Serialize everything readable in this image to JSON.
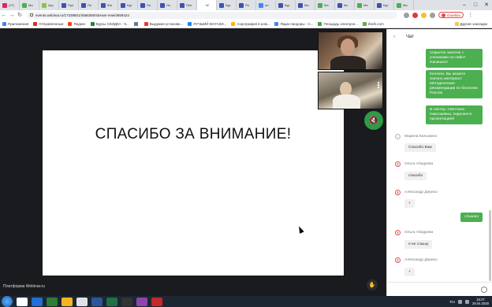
{
  "browser": {
    "tabs": [
      {
        "title": "(27)",
        "color": "#e0245e"
      },
      {
        "title": "Ма",
        "color": "#4caf50"
      },
      {
        "title": "Арс",
        "color": "#8bc34a"
      },
      {
        "title": "Пре",
        "color": "#3f51b5"
      },
      {
        "title": "Ли",
        "color": "#3f51b5"
      },
      {
        "title": "Жи",
        "color": "#3f51b5"
      },
      {
        "title": "Кур",
        "color": "#3f51b5"
      },
      {
        "title": "Ли",
        "color": "#3f51b5"
      },
      {
        "title": "Но",
        "color": "#3f51b5"
      },
      {
        "title": "Пен",
        "color": "#3f51b5"
      },
      {
        "title": "W",
        "color": "#ffffff"
      },
      {
        "title": "Кур",
        "color": "#3f51b5"
      },
      {
        "title": "Ра",
        "color": "#3f51b5"
      },
      {
        "title": "ал",
        "color": "#4285f4"
      },
      {
        "title": "Кур",
        "color": "#3f51b5"
      },
      {
        "title": "Ма",
        "color": "#3f51b5"
      },
      {
        "title": "Ма",
        "color": "#4caf50"
      },
      {
        "title": "bio",
        "color": "#3f51b5"
      },
      {
        "title": "Ма",
        "color": "#4caf50"
      },
      {
        "title": "Кур",
        "color": "#3f51b5"
      },
      {
        "title": "Ма",
        "color": "#4caf50"
      }
    ],
    "active_tab": 10,
    "url": "events.webinar.ru/17339801/4566360/stream-new/4658424",
    "profile_label": "Ошибка",
    "bookmarks": [
      {
        "label": "Приложения",
        "color": "#4285f4"
      },
      {
        "label": "Отправленные",
        "color": "#d93025"
      },
      {
        "label": "Яндекс",
        "color": "#fc3f1d"
      },
      {
        "label": "Курсы СКИДКА - 5...",
        "color": "#2e7d32"
      },
      {
        "label": "",
        "color": "#607d8b"
      },
      {
        "label": "Выдумая установк...",
        "color": "#e53935"
      },
      {
        "label": "ЛУЧШИЙ МАГАЗИ...",
        "color": "#1e88e5"
      },
      {
        "label": "Аэрография в аэ&...",
        "color": "#ffb300"
      },
      {
        "label": "Ящик пандоры - С...",
        "color": "#4285f4"
      },
      {
        "label": "Площадь электрон...",
        "color": "#43a047"
      },
      {
        "label": "iherb.com",
        "color": "#6aa84f"
      }
    ],
    "bookmarks_other": "Другие закладки"
  },
  "stage": {
    "slide_text": "СПАСИБО ЗА ВНИМАНИЕ!",
    "brand": "Платформа Webinar.ru"
  },
  "chat": {
    "title": "Чат",
    "outgoing": [
      "открытое занятие с учениками он-лайн? Напишите",
      "Коллеги. Вы можете скачать материал: Методические рекомендации по биологии Рохлов",
      "И лектор, Светлана Николаевна, поделился презентацией"
    ],
    "messages": [
      {
        "sender": "Марина Балыкина",
        "text": "Спасибо Вам",
        "avatar": "grey"
      },
      {
        "sender": "Ольга Абидуева",
        "text": "спасибо",
        "avatar": "red"
      },
      {
        "sender": "Александр Дерихо",
        "text": "+",
        "avatar": "red"
      },
      {
        "own": "слышно"
      },
      {
        "sender": "Ольга Абидуева",
        "text": "я не слышу",
        "avatar": "red"
      },
      {
        "sender": "Александр Дерихо",
        "text": "+",
        "avatar": "red"
      }
    ]
  },
  "taskbar": {
    "lang": "RU",
    "time": "15:27",
    "date": "29.04.2020",
    "apps": [
      "#ffffff",
      "#1f6fd6",
      "#2e7d32",
      "#f3b61f",
      "#dfe3e8",
      "#2b579a",
      "#1e7145",
      "#333333",
      "#8e44ad",
      "#c62828"
    ]
  }
}
